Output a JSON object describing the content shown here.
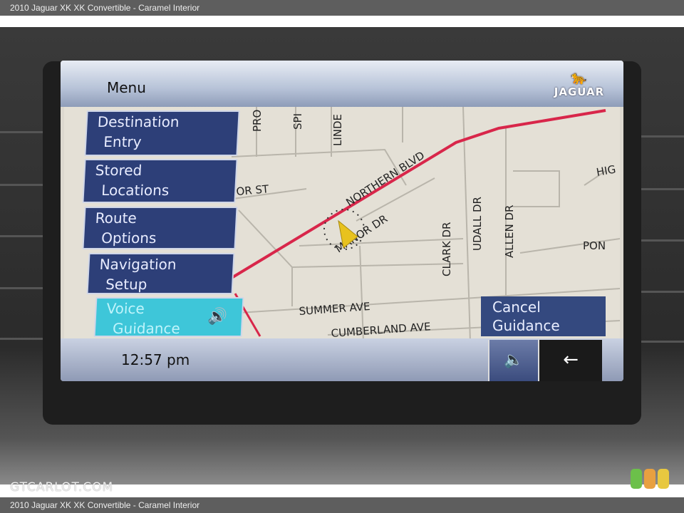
{
  "caption": "2010 Jaguar XK XK Convertible - Caramel Interior",
  "watermark": "GTCARLOT.COM",
  "header": {
    "menu_label": "Menu",
    "logo_text": "JAGUAR"
  },
  "menu": {
    "items": [
      {
        "line1": "Destination",
        "line2": "Entry"
      },
      {
        "line1": "Stored",
        "line2": "Locations"
      },
      {
        "line1": "Route",
        "line2": "Options"
      },
      {
        "line1": "Navigation",
        "line2": "Setup"
      },
      {
        "line1": "Voice",
        "line2": "Guidance",
        "icon": "speaker-icon",
        "active": true
      }
    ]
  },
  "map": {
    "streets": {
      "pro": "PRO",
      "spi": "SPI",
      "linde": "LINDE",
      "northern": "NORTHERN BLVD",
      "manor": "MANOR DR",
      "borst": "BOR ST",
      "clark": "CLARK DR",
      "udall": "UDALL DR",
      "allen": "ALLEN DR",
      "hig": "HIG",
      "pon": "PON",
      "summer": "SUMMER AVE",
      "cumberland": "CUMBERLAND AVE"
    },
    "route_color": "#d8264a",
    "vehicle_color": "#e8c21e"
  },
  "cancel": {
    "line1": "Cancel",
    "line2": "Guidance"
  },
  "status": {
    "time": "12:57 pm"
  },
  "controls": {
    "mute_icon": "speaker-icon",
    "back_icon": "back-arrow-icon",
    "mute_glyph": "🔈",
    "back_glyph": "←"
  },
  "colors": {
    "menu_button": "#2d3f78",
    "active_button": "#3ec6d9"
  }
}
